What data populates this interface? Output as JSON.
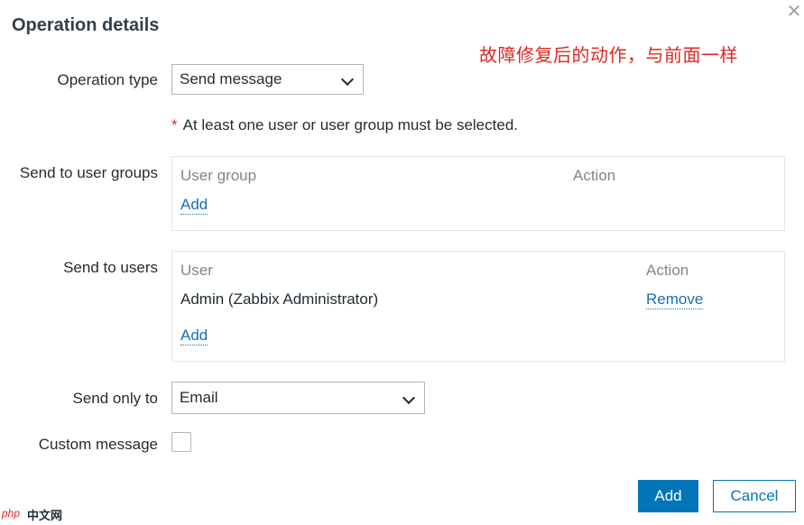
{
  "dialog": {
    "title": "Operation details",
    "close_icon": "close-icon"
  },
  "annotation": "故障修复后的动作，与前面一样",
  "operation_type": {
    "label": "Operation type",
    "value": "Send message"
  },
  "required_note": {
    "asterisk": "*",
    "text": "At least one user or user group must be selected."
  },
  "user_groups": {
    "label": "Send to user groups",
    "columns": [
      "User group",
      "Action"
    ],
    "add_label": "Add"
  },
  "users": {
    "label": "Send to users",
    "columns": [
      "User",
      "Action"
    ],
    "rows": [
      {
        "user": "Admin (Zabbix Administrator)",
        "action": "Remove"
      }
    ],
    "add_label": "Add"
  },
  "send_only_to": {
    "label": "Send only to",
    "value": "Email"
  },
  "custom_message": {
    "label": "Custom message",
    "checked": false
  },
  "footer": {
    "add_label": "Add",
    "cancel_label": "Cancel"
  },
  "watermark": {
    "php": "php",
    "site": "中文网"
  },
  "colors": {
    "primary": "#0275b8",
    "link": "#1a6fb3",
    "required": "#e0271f",
    "annotation": "#e0271f"
  }
}
